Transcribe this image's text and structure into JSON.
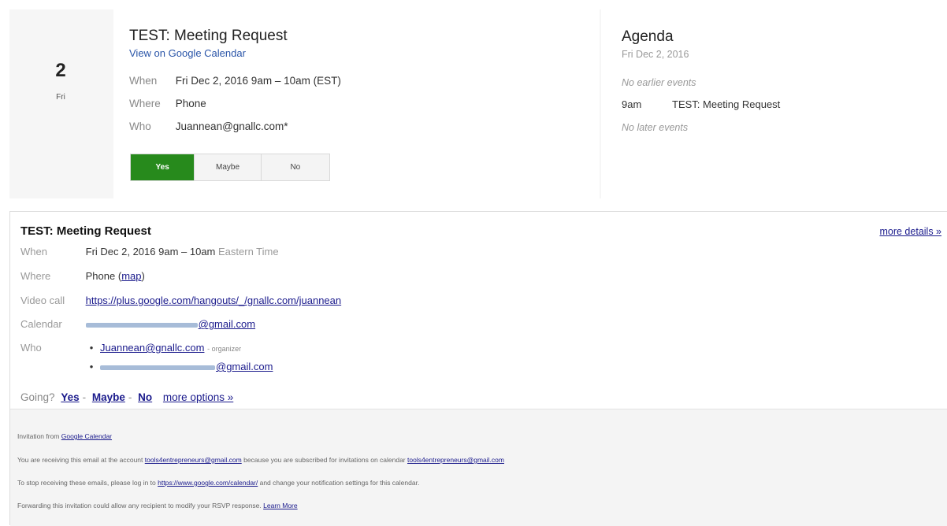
{
  "top": {
    "date_number": "2",
    "day_of_week": "Fri",
    "title": "TEST: Meeting Request",
    "view_link": "View on Google Calendar",
    "rows": [
      {
        "label": "When",
        "value": "Fri Dec 2, 2016 9am – 10am (EST)"
      },
      {
        "label": "Where",
        "value": "Phone"
      },
      {
        "label": "Who",
        "value": "Juannean@gnallc.com*"
      }
    ],
    "rsvp": {
      "yes": "Yes",
      "maybe": "Maybe",
      "no": "No",
      "selected": "Yes",
      "selected_color": "#278a1c"
    }
  },
  "agenda": {
    "title": "Agenda",
    "date": "Fri Dec 2, 2016",
    "earlier": "No earlier events",
    "event_time": "9am",
    "event_title": "TEST: Meeting Request",
    "later": "No later events"
  },
  "detail": {
    "title": "TEST: Meeting Request",
    "more_details": "more details »",
    "when_label": "When",
    "when_value": "Fri Dec 2, 2016 9am – 10am",
    "when_tz": "Eastern Time",
    "where_label": "Where",
    "where_value": "Phone",
    "map_link": "map",
    "video_label": "Video call",
    "video_link": "https://plus.google.com/hangouts/_/gnallc.com/juannean",
    "calendar_label": "Calendar",
    "calendar_value": "@gmail.com",
    "who_label": "Who",
    "who": [
      {
        "email": "Juannean@gnallc.com",
        "role": "- organizer"
      },
      {
        "email": "@gmail.com",
        "role": ""
      }
    ],
    "going_label": "Going?",
    "going_yes": "Yes",
    "going_maybe": "Maybe",
    "going_no": "No",
    "going_sep": "-",
    "more_options": "more options »"
  },
  "footer": {
    "line1_text": "Invitation from ",
    "line1_link": "Google Calendar",
    "line2_a": "You are receiving this email at the account ",
    "line2_link1": "tools4entrepreneurs@gmail.com",
    "line2_b": " because you are subscribed for invitations on calendar ",
    "line2_link2": "tools4entrepreneurs@gmail.com",
    "line3_a": "To stop receiving these emails, please log in to ",
    "line3_link": "https://www.google.com/calendar/",
    "line3_b": " and change your notification settings for this calendar.",
    "line4_a": "Forwarding this invitation could allow any recipient to modify your RSVP response. ",
    "line4_link": "Learn More"
  }
}
